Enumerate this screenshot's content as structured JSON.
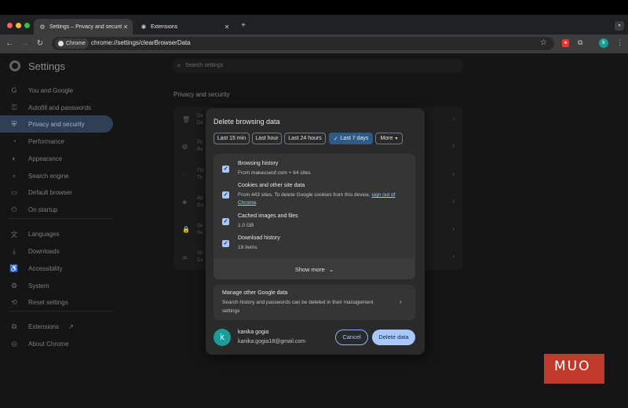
{
  "tabs": [
    {
      "title": "Settings – Privacy and security",
      "icon": "gear-icon"
    },
    {
      "title": "Extensions",
      "icon": "puzzle-icon"
    }
  ],
  "toolbar": {
    "chip_label": "Chrome",
    "url": "chrome://settings/clearBrowserData"
  },
  "settings": {
    "title": "Settings",
    "search_placeholder": "Search settings",
    "section_title": "Privacy and security",
    "sidebar": [
      {
        "label": "You and Google",
        "icon": "google-icon"
      },
      {
        "label": "Autofill and passwords",
        "icon": "key-icon"
      },
      {
        "label": "Privacy and security",
        "icon": "shield-icon",
        "active": true
      },
      {
        "label": "Performance",
        "icon": "speedometer-icon"
      },
      {
        "label": "Appearance",
        "icon": "palette-icon"
      },
      {
        "label": "Search engine",
        "icon": "search-icon"
      },
      {
        "label": "Default browser",
        "icon": "browser-icon"
      },
      {
        "label": "On startup",
        "icon": "power-icon"
      },
      {
        "label": "Languages",
        "icon": "translate-icon"
      },
      {
        "label": "Downloads",
        "icon": "download-icon"
      },
      {
        "label": "Accessibility",
        "icon": "accessibility-icon"
      },
      {
        "label": "System",
        "icon": "wrench-icon"
      },
      {
        "label": "Reset settings",
        "icon": "reset-icon"
      },
      {
        "label": "Extensions",
        "icon": "extension-icon"
      },
      {
        "label": "About Chrome",
        "icon": "chrome-icon"
      }
    ],
    "bg_rows": [
      {
        "text": "De\nDe"
      },
      {
        "text": "Pri\nRe"
      },
      {
        "text": "Thi\nTh"
      },
      {
        "text": "Ad\nCu"
      },
      {
        "text": "Se\nSa"
      },
      {
        "text": "Sit\nCo"
      }
    ]
  },
  "dialog": {
    "title": "Delete browsing data",
    "ranges": [
      {
        "label": "Last 15 min",
        "selected": false
      },
      {
        "label": "Last hour",
        "selected": false
      },
      {
        "label": "Last 24 hours",
        "selected": false
      },
      {
        "label": "Last 7 days",
        "selected": true
      },
      {
        "label": "More",
        "selected": false
      }
    ],
    "options": [
      {
        "title": "Browsing history",
        "desc": "From makeuseof.com + 64 sites",
        "checked": true
      },
      {
        "title": "Cookies and other site data",
        "desc": "From 443 sites. To delete Google cookies from this device,",
        "link": "sign out of Chrome",
        "desc_end": ".",
        "checked": true
      },
      {
        "title": "Cached images and files",
        "desc": "1.0 GB",
        "checked": true
      },
      {
        "title": "Download history",
        "desc": "19 items",
        "checked": true
      }
    ],
    "show_more": "Show more",
    "manage": {
      "title": "Manage other Google data",
      "desc": "Search history and passwords can be deleted in their management settings"
    },
    "account": {
      "initial": "k",
      "name": "kanika gogia",
      "email": "kanika.gogia18@gmail.com"
    },
    "cancel_label": "Cancel",
    "delete_label": "Delete data"
  },
  "watermark": "MUO",
  "colors": {
    "accent": "#a8c7fa",
    "selected_chip": "#2d5a86",
    "avatar": "#1a9c98",
    "watermark": "#c0392b"
  }
}
